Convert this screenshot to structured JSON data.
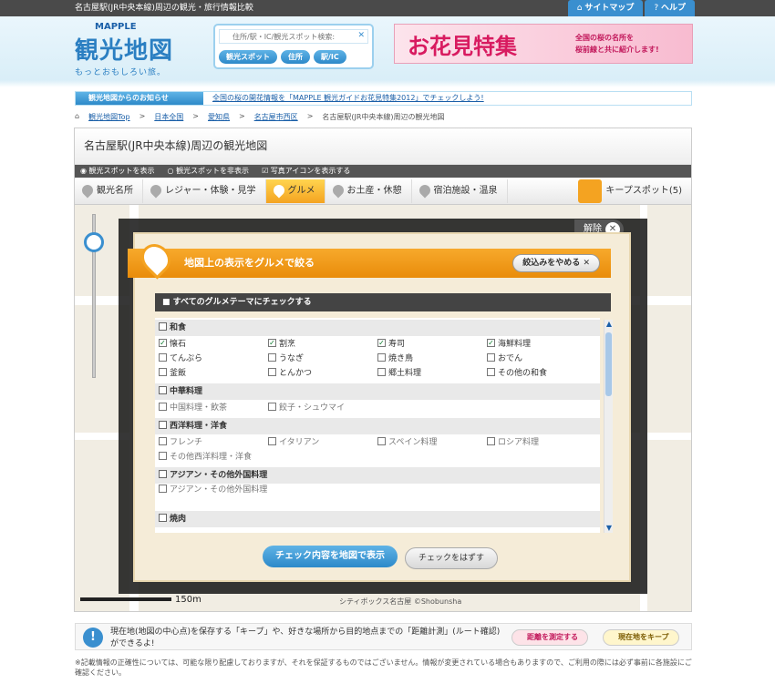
{
  "topbar": {
    "title": "名古屋駅(JR中央本線)周辺の観光・旅行情報比較",
    "sitemap": "サイトマップ",
    "help": "ヘルプ"
  },
  "header": {
    "brand": "MAPPLE",
    "logo_main": "観光地図",
    "logo_sub": "もっとおもしろい旅。",
    "search_placeholder": "住所/駅・IC/観光スポット検索:",
    "search_buttons": [
      "観光スポット",
      "住所",
      "駅/IC"
    ],
    "banner_title": "お花見特集",
    "banner_sub_1": "全国の桜の名所を",
    "banner_sub_2": "桜前線と共に紹介します!"
  },
  "news": {
    "label": "観光地図からのお知らせ",
    "text": "全国の桜の開花情報を「MAPPLE 観光ガイドお花見特集2012」でチェックしよう!"
  },
  "breadcrumb": [
    "観光地図Top",
    "日本全国",
    "愛知県",
    "名古屋市西区",
    "名古屋駅(JR中央本線)周辺の観光地図"
  ],
  "panel": {
    "title": "名古屋駅(JR中央本線)周辺の観光地図",
    "options": [
      "観光スポットを表示",
      "観光スポットを非表示",
      "写真アイコンを表示する"
    ],
    "tabs": [
      "観光名所",
      "レジャー・体験・見学",
      "グルメ",
      "お土産・休憩",
      "宿泊施設・温泉"
    ],
    "keep": "キープスポット(5)",
    "scale": "150m",
    "copyright": "シティボックス名古屋 ©Shobunsha",
    "close_chip": "解除"
  },
  "modal": {
    "title": "地図上の表示をグルメで絞る",
    "stop_button": "絞込みをやめる",
    "all_check": "すべてのグルメテーマにチェックする",
    "categories": [
      {
        "name": "和食",
        "items": [
          {
            "label": "懐石",
            "checked": "✓"
          },
          {
            "label": "割烹",
            "checked": "✓"
          },
          {
            "label": "寿司",
            "checked": "✓"
          },
          {
            "label": "海鮮料理",
            "checked": "✓"
          },
          {
            "label": "てんぷら",
            "checked": ""
          },
          {
            "label": "うなぎ",
            "checked": ""
          },
          {
            "label": "焼き鳥",
            "checked": ""
          },
          {
            "label": "おでん",
            "checked": ""
          },
          {
            "label": "釜飯",
            "checked": ""
          },
          {
            "label": "とんかつ",
            "checked": ""
          },
          {
            "label": "郷土料理",
            "checked": ""
          },
          {
            "label": "その他の和食",
            "checked": ""
          }
        ]
      },
      {
        "name": "中華料理",
        "items": [
          {
            "label": "中国料理・飲茶",
            "checked": ""
          },
          {
            "label": "餃子・シュウマイ",
            "checked": ""
          }
        ]
      },
      {
        "name": "西洋料理・洋食",
        "items": [
          {
            "label": "フレンチ",
            "checked": ""
          },
          {
            "label": "イタリアン",
            "checked": ""
          },
          {
            "label": "スペイン料理",
            "checked": ""
          },
          {
            "label": "ロシア料理",
            "checked": ""
          },
          {
            "label": "その他西洋料理・洋食",
            "checked": ""
          }
        ]
      },
      {
        "name": "アジアン・その他外国料理",
        "items": [
          {
            "label": "アジアン・その他外国料理",
            "checked": ""
          }
        ]
      },
      {
        "name": "焼肉",
        "items": []
      }
    ],
    "apply_button": "チェック内容を地図で表示",
    "clear_button": "チェックをはずす"
  },
  "footer": {
    "info": "現在地(地図の中心点)を保存する「キープ」や、好きな場所から目的地点までの「距離計測」(ルート確認)ができるよ!",
    "measure_button": "距離を測定する",
    "keep_button": "現在地をキープ",
    "disclaimer": "※記載情報の正確性については、可能な限り配慮しておりますが、それを保証するものではございません。情報が変更されている場合もありますので、ご利用の際には必ず事前に各施設にご確認ください。"
  },
  "colors": {
    "accent": "#2d89c9",
    "orange": "#f4a321",
    "pink": "#d81b60"
  }
}
